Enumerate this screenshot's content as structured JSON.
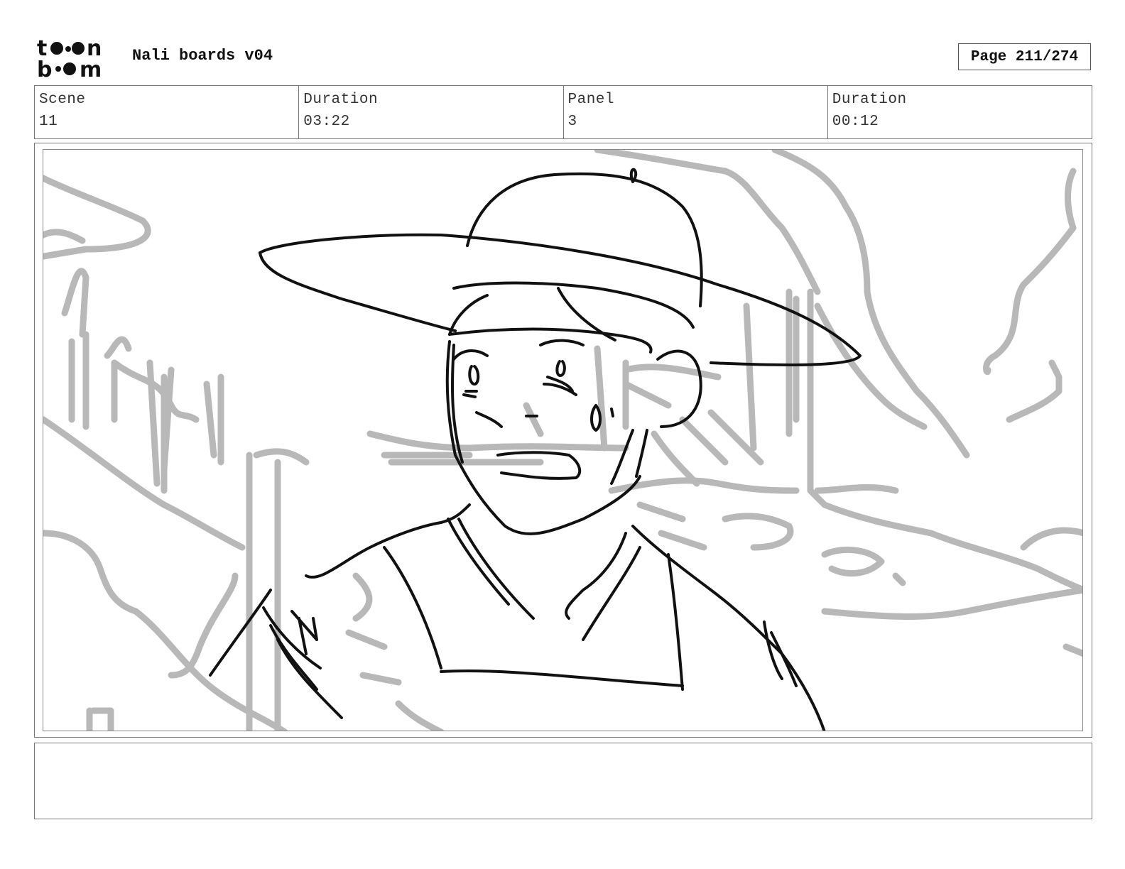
{
  "header": {
    "logo_text": "toonboom",
    "project_title": "Nali boards v04",
    "page_label": "Page 211/274"
  },
  "info": {
    "scene_label": "Scene",
    "scene_value": "11",
    "scene_duration_label": "Duration",
    "scene_duration_value": "03:22",
    "panel_label": "Panel",
    "panel_value": "3",
    "panel_duration_label": "Duration",
    "panel_duration_value": "00:12"
  },
  "panel": {
    "image_alt": "Storyboard sketch: a young man in a wide-brimmed hat looking nervous, sweat drop on cheek, rough grey background sketch",
    "notes": ""
  },
  "colors": {
    "line_dark": "#111111",
    "line_grey": "#b5b5b5",
    "border": "#777777"
  }
}
